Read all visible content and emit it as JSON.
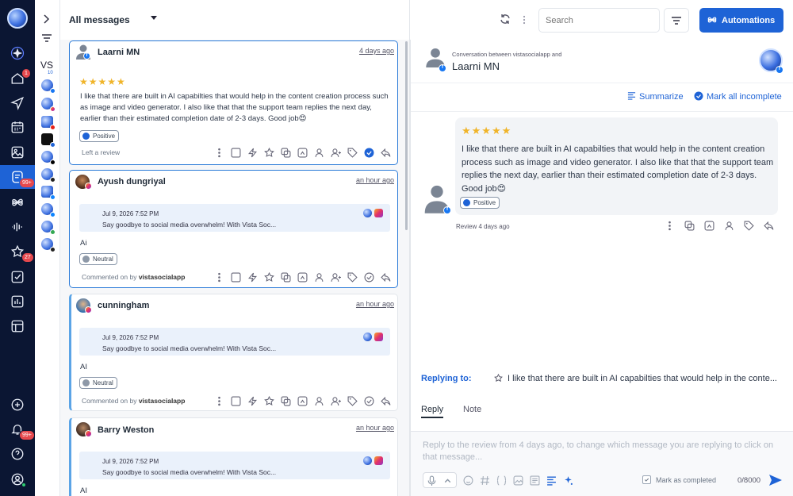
{
  "nav": {
    "items": [
      {
        "name": "home",
        "badge": "1"
      },
      {
        "name": "publish",
        "badge": ""
      },
      {
        "name": "calendar",
        "badge": ""
      },
      {
        "name": "media",
        "badge": ""
      },
      {
        "name": "inbox",
        "badge": "99+"
      },
      {
        "name": "integrations",
        "badge": ""
      },
      {
        "name": "listening",
        "badge": ""
      },
      {
        "name": "reviews",
        "badge": "27"
      },
      {
        "name": "tasks",
        "badge": ""
      },
      {
        "name": "reports",
        "badge": ""
      },
      {
        "name": "templates",
        "badge": ""
      }
    ],
    "notifications_badge": "99+"
  },
  "profiles": {
    "label": "VS",
    "count": "10"
  },
  "list": {
    "filter_label": "All messages",
    "cards": [
      {
        "author": "Laarni MN",
        "time": "4 days ago",
        "stars": "★★★★★",
        "text": "I like that there are built in AI capabilties that would help in the content creation process such as image and video generator. I also like that that the support team replies the next day, earlier than their estimated completion date of 2-3 days. Good job😍",
        "sentiment": "Positive",
        "note": "Left a review"
      },
      {
        "author": "Ayush dungriyal",
        "time": "an hour ago",
        "quote_date": "Jul 9, 2026 7:52 PM",
        "quote_text": "Say goodbye to social media overwhelm!     With Vista Soc...",
        "comment": "Ai",
        "sentiment": "Neutral",
        "note_prefix": "Commented on by",
        "note_author": "vistasocialapp"
      },
      {
        "author": "cunningham",
        "time": "an hour ago",
        "quote_date": "Jul 9, 2026 7:52 PM",
        "quote_text": "Say goodbye to social media overwhelm!     With Vista Soc...",
        "comment": "AI",
        "sentiment": "Neutral",
        "note_prefix": "Commented on by",
        "note_author": "vistasocialapp"
      },
      {
        "author": "Barry Weston",
        "time": "an hour ago",
        "quote_date": "Jul 9, 2026 7:52 PM",
        "quote_text": "Say goodbye to social media overwhelm!     With Vista Soc...",
        "comment": "AI"
      }
    ]
  },
  "toolbar": {
    "search_placeholder": "Search",
    "automations_label": "Automations"
  },
  "conversation": {
    "subtitle": "Conversation between vistasocialapp and",
    "name": "Laarni MN",
    "summarize_label": "Summarize",
    "mark_all_label": "Mark all incomplete",
    "stars": "★★★★★",
    "text": "I like that there are built in AI capabilties that would help in the content creation process such as image and video generator. I also like that that the support team replies the next day, earlier than their estimated completion date of 2-3 days. Good job😍",
    "sentiment": "Positive",
    "meta": "Review 4 days ago",
    "replying_label": "Replying to:",
    "replying_quote": "I like that there are built in AI capabilties that would help in the conte...",
    "tabs": [
      "Reply",
      "Note"
    ],
    "composer_placeholder": "Reply to the review from 4 days ago, to change which message you are replying to click on that message...",
    "mark_completed_label": "Mark as completed",
    "char_count": "0/8000"
  },
  "colors": {
    "accent": "#1e63d6",
    "nav_bg": "#0b1633",
    "star": "#f0b429"
  }
}
